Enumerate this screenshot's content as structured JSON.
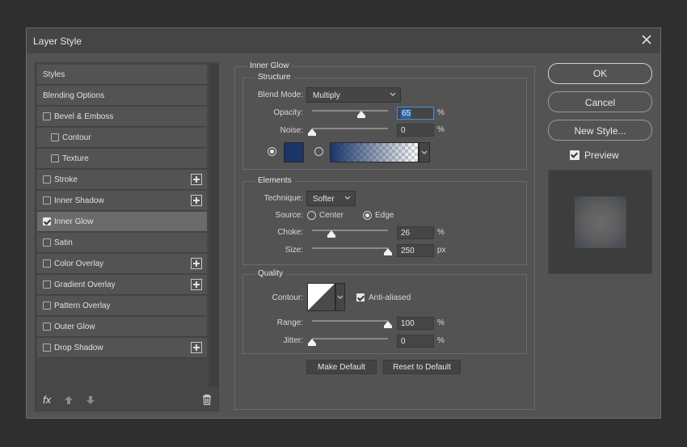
{
  "dialog": {
    "title": "Layer Style"
  },
  "left": {
    "items": [
      {
        "label": "Styles",
        "checkbox": false,
        "checked": false,
        "plus": false,
        "indent": false
      },
      {
        "label": "Blending Options",
        "checkbox": false,
        "checked": false,
        "plus": false,
        "indent": false
      },
      {
        "label": "Bevel & Emboss",
        "checkbox": true,
        "checked": false,
        "plus": false,
        "indent": false
      },
      {
        "label": "Contour",
        "checkbox": true,
        "checked": false,
        "plus": false,
        "indent": true
      },
      {
        "label": "Texture",
        "checkbox": true,
        "checked": false,
        "plus": false,
        "indent": true
      },
      {
        "label": "Stroke",
        "checkbox": true,
        "checked": false,
        "plus": true,
        "indent": false
      },
      {
        "label": "Inner Shadow",
        "checkbox": true,
        "checked": false,
        "plus": true,
        "indent": false
      },
      {
        "label": "Inner Glow",
        "checkbox": true,
        "checked": true,
        "plus": false,
        "indent": false,
        "selected": true
      },
      {
        "label": "Satin",
        "checkbox": true,
        "checked": false,
        "plus": false,
        "indent": false
      },
      {
        "label": "Color Overlay",
        "checkbox": true,
        "checked": false,
        "plus": true,
        "indent": false
      },
      {
        "label": "Gradient Overlay",
        "checkbox": true,
        "checked": false,
        "plus": true,
        "indent": false
      },
      {
        "label": "Pattern Overlay",
        "checkbox": true,
        "checked": false,
        "plus": false,
        "indent": false
      },
      {
        "label": "Outer Glow",
        "checkbox": true,
        "checked": false,
        "plus": false,
        "indent": false
      },
      {
        "label": "Drop Shadow",
        "checkbox": true,
        "checked": false,
        "plus": true,
        "indent": false
      }
    ],
    "fx_label": "fx"
  },
  "inner_glow": {
    "title": "Inner Glow",
    "structure": {
      "title": "Structure",
      "blend_mode_label": "Blend Mode:",
      "blend_mode": "Multiply",
      "opacity_label": "Opacity:",
      "opacity": "65",
      "opacity_unit": "%",
      "noise_label": "Noise:",
      "noise": "0",
      "noise_unit": "%",
      "glow_color": "#1a3568"
    },
    "elements": {
      "title": "Elements",
      "technique_label": "Technique:",
      "technique": "Softer",
      "source_label": "Source:",
      "source_center": "Center",
      "source_edge": "Edge",
      "choke_label": "Choke:",
      "choke": "26",
      "choke_unit": "%",
      "size_label": "Size:",
      "size": "250",
      "size_unit": "px"
    },
    "quality": {
      "title": "Quality",
      "contour_label": "Contour:",
      "anti_aliased": "Anti-aliased",
      "range_label": "Range:",
      "range": "100",
      "range_unit": "%",
      "jitter_label": "Jitter:",
      "jitter": "0",
      "jitter_unit": "%"
    },
    "make_default": "Make Default",
    "reset_default": "Reset to Default"
  },
  "right": {
    "ok": "OK",
    "cancel": "Cancel",
    "new_style": "New Style...",
    "preview": "Preview"
  }
}
